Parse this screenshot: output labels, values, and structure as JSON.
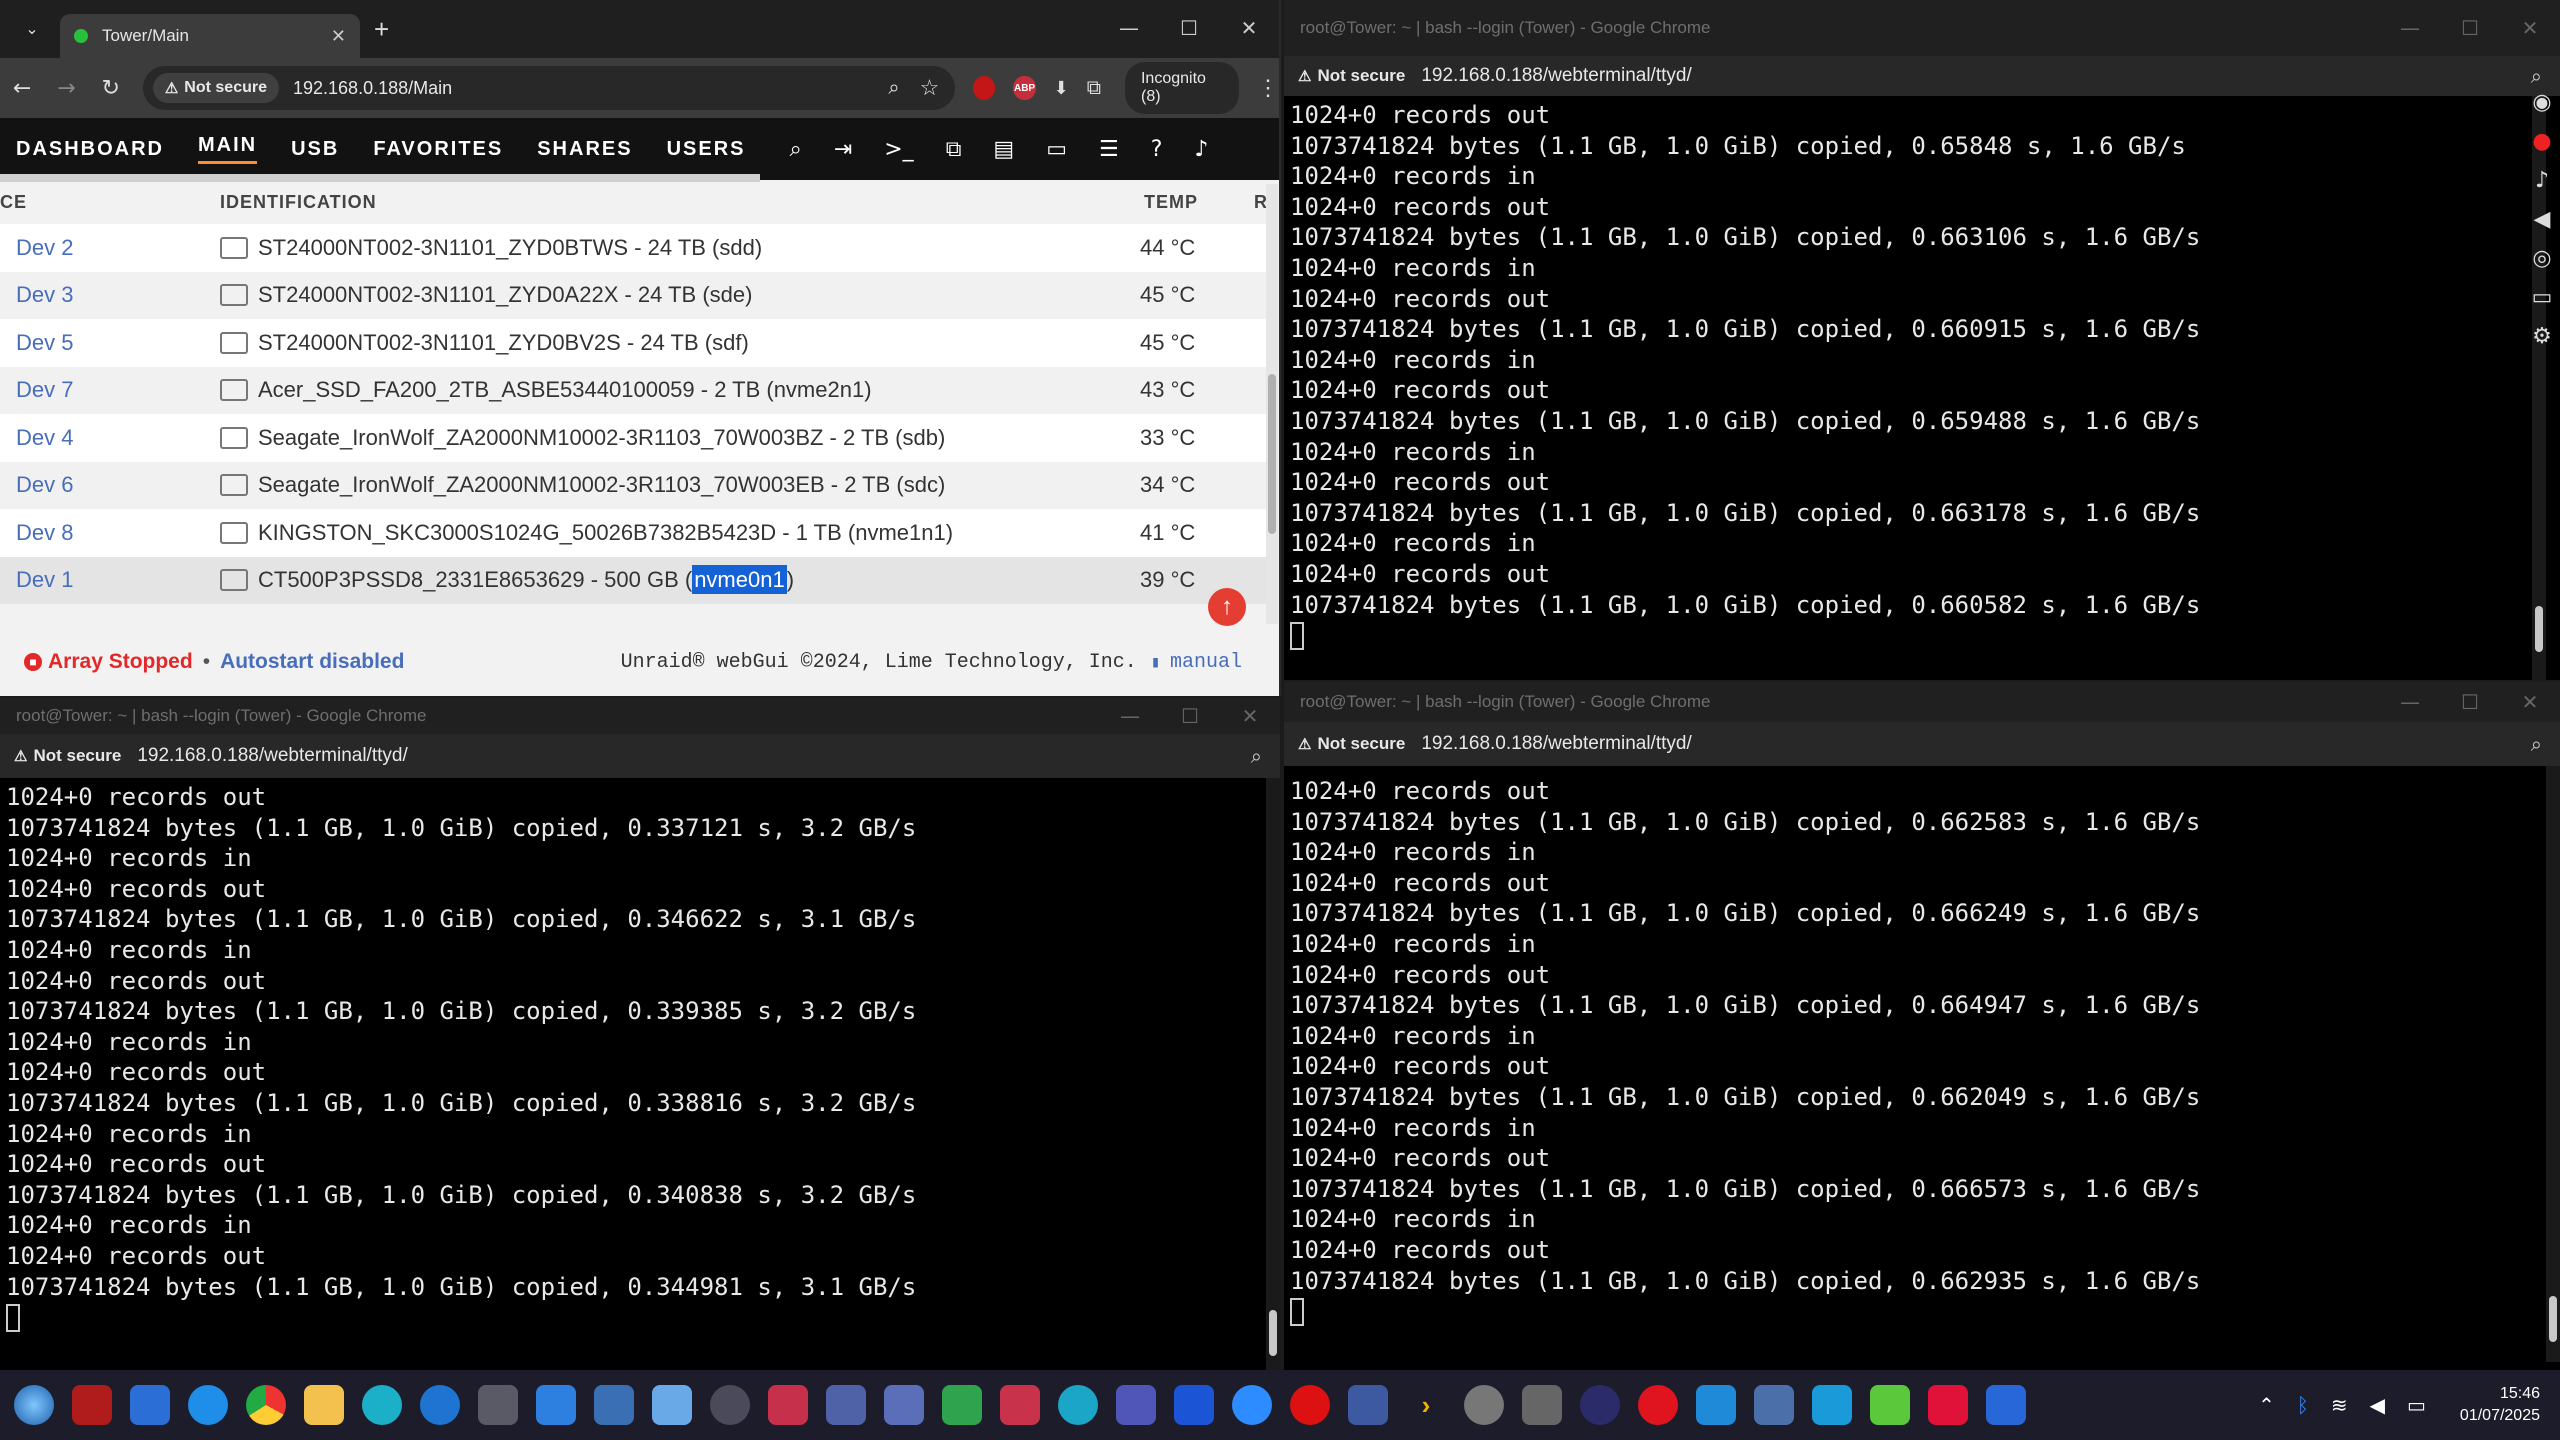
{
  "unraid_window": {
    "tab_title": "Tower/Main",
    "security_label": "Not secure",
    "url": "192.168.0.188/Main",
    "incognito_label": "Incognito (8)",
    "nav": [
      "DASHBOARD",
      "MAIN",
      "USB",
      "FAVORITES",
      "SHARES",
      "USERS"
    ],
    "active_nav": "MAIN",
    "columns": {
      "device": "CE",
      "identification": "IDENTIFICATION",
      "temp": "TEMP",
      "extra": "R"
    },
    "devices": [
      {
        "dev": "Dev 2",
        "id": "ST24000NT002-3N1101_ZYD0BTWS - 24 TB (sdd)",
        "temp": "44 °C"
      },
      {
        "dev": "Dev 3",
        "id": "ST24000NT002-3N1101_ZYD0A22X - 24 TB (sde)",
        "temp": "45 °C"
      },
      {
        "dev": "Dev 5",
        "id": "ST24000NT002-3N1101_ZYD0BV2S - 24 TB (sdf)",
        "temp": "45 °C"
      },
      {
        "dev": "Dev 7",
        "id": "Acer_SSD_FA200_2TB_ASBE53440100059 - 2 TB (nvme2n1)",
        "temp": "43 °C"
      },
      {
        "dev": "Dev 4",
        "id": "Seagate_IronWolf_ZA2000NM10002-3R1103_70W003BZ - 2 TB (sdb)",
        "temp": "33 °C"
      },
      {
        "dev": "Dev 6",
        "id": "Seagate_IronWolf_ZA2000NM10002-3R1103_70W003EB - 2 TB (sdc)",
        "temp": "34 °C"
      },
      {
        "dev": "Dev 8",
        "id": "KINGSTON_SKC3000S1024G_50026B7382B5423D - 1 TB (nvme1n1)",
        "temp": "41 °C"
      }
    ],
    "selected_device": {
      "dev": "Dev 1",
      "id_prefix": "CT500P3PSSD8_2331E8653629 - 500 GB (",
      "id_highlight": "nvme0n1",
      "id_suffix": ")",
      "temp": "39 °C"
    },
    "footer": {
      "status": "Array Stopped",
      "bullet": "•",
      "autostart": "Autostart disabled",
      "copyright": "Unraid® webGui ©2024, Lime Technology, Inc.",
      "manual": "manual"
    }
  },
  "terminal_top_right": {
    "title": "root@Tower: ~ | bash --login (Tower) - Google Chrome",
    "security_label": "Not secure",
    "url": "192.168.0.188/webterminal/ttyd/",
    "text": "1024+0 records out\n1073741824 bytes (1.1 GB, 1.0 GiB) copied, 0.65848 s, 1.6 GB/s\n1024+0 records in\n1024+0 records out\n1073741824 bytes (1.1 GB, 1.0 GiB) copied, 0.663106 s, 1.6 GB/s\n1024+0 records in\n1024+0 records out\n1073741824 bytes (1.1 GB, 1.0 GiB) copied, 0.660915 s, 1.6 GB/s\n1024+0 records in\n1024+0 records out\n1073741824 bytes (1.1 GB, 1.0 GiB) copied, 0.659488 s, 1.6 GB/s\n1024+0 records in\n1024+0 records out\n1073741824 bytes (1.1 GB, 1.0 GiB) copied, 0.663178 s, 1.6 GB/s\n1024+0 records in\n1024+0 records out\n1073741824 bytes (1.1 GB, 1.0 GiB) copied, 0.660582 s, 1.6 GB/s"
  },
  "terminal_bottom_left": {
    "title": "root@Tower: ~ | bash --login (Tower) - Google Chrome",
    "security_label": "Not secure",
    "url": "192.168.0.188/webterminal/ttyd/",
    "text": "1024+0 records out\n1073741824 bytes (1.1 GB, 1.0 GiB) copied, 0.337121 s, 3.2 GB/s\n1024+0 records in\n1024+0 records out\n1073741824 bytes (1.1 GB, 1.0 GiB) copied, 0.346622 s, 3.1 GB/s\n1024+0 records in\n1024+0 records out\n1073741824 bytes (1.1 GB, 1.0 GiB) copied, 0.339385 s, 3.2 GB/s\n1024+0 records in\n1024+0 records out\n1073741824 bytes (1.1 GB, 1.0 GiB) copied, 0.338816 s, 3.2 GB/s\n1024+0 records in\n1024+0 records out\n1073741824 bytes (1.1 GB, 1.0 GiB) copied, 0.340838 s, 3.2 GB/s\n1024+0 records in\n1024+0 records out\n1073741824 bytes (1.1 GB, 1.0 GiB) copied, 0.344981 s, 3.1 GB/s"
  },
  "terminal_bottom_right": {
    "title": "root@Tower: ~ | bash --login (Tower) - Google Chrome",
    "security_label": "Not secure",
    "url": "192.168.0.188/webterminal/ttyd/",
    "text": "1024+0 records out\n1073741824 bytes (1.1 GB, 1.0 GiB) copied, 0.662583 s, 1.6 GB/s\n1024+0 records in\n1024+0 records out\n1073741824 bytes (1.1 GB, 1.0 GiB) copied, 0.666249 s, 1.6 GB/s\n1024+0 records in\n1024+0 records out\n1073741824 bytes (1.1 GB, 1.0 GiB) copied, 0.664947 s, 1.6 GB/s\n1024+0 records in\n1024+0 records out\n1073741824 bytes (1.1 GB, 1.0 GiB) copied, 0.662049 s, 1.6 GB/s\n1024+0 records in\n1024+0 records out\n1073741824 bytes (1.1 GB, 1.0 GiB) copied, 0.666573 s, 1.6 GB/s\n1024+0 records in\n1024+0 records out\n1073741824 bytes (1.1 GB, 1.0 GiB) copied, 0.662935 s, 1.6 GB/s"
  },
  "extension_badges": {
    "abp": "ABP"
  },
  "taskbar": {
    "apps": [
      "start-icon",
      "terminal-app-icon",
      "window-app-icon",
      "edge-icon",
      "chrome-icon",
      "file-explorer-icon",
      "search-app-icon",
      "teamviewer-icon",
      "calculator-app-icon",
      "store-icon",
      "notepad-icon",
      "paint-icon",
      "settings-icon",
      "snipping-icon",
      "photos-icon",
      "remote-icon",
      "spreadsheet-icon",
      "calendar-icon",
      "edge-browser-icon",
      "teams-icon",
      "u-app-icon",
      "zoom-icon",
      "record-icon",
      "network-icon",
      "arrow-icon",
      "nav-icon",
      "phone-icon",
      "camera-icon",
      "opera-icon",
      "photo-app-icon",
      "calc-icon",
      "bars-app-icon",
      "cube-icon",
      "pdf-icon",
      "ide-icon"
    ],
    "time": "15:46",
    "date": "01/07/2025"
  }
}
